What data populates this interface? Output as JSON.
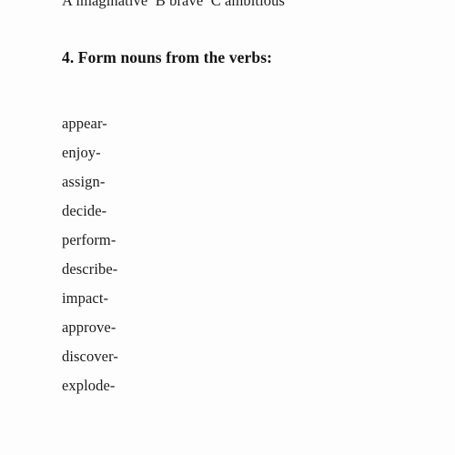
{
  "document": {
    "background_color": "#fdfdfd",
    "text_color": "#1a1a1a",
    "clipped_previous_line": "A imaginative  B brave  C ambitious",
    "section": {
      "heading": "4. Form nouns from the verbs:",
      "verbs": [
        "appear-",
        "enjoy-",
        "assign-",
        "decide-",
        "perform-",
        "describe-",
        "impact-",
        "approve-",
        "discover-",
        "explode-"
      ]
    }
  }
}
